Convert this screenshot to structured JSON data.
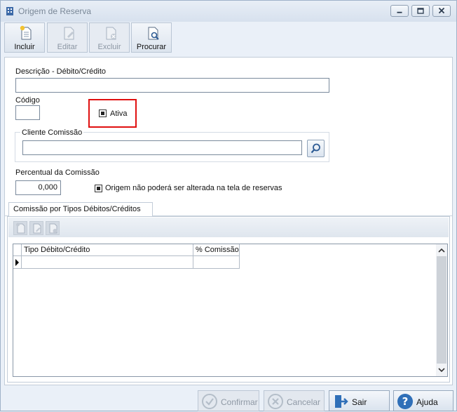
{
  "window": {
    "title": "Origem de Reserva"
  },
  "toolbar": {
    "incluir": "Incluir",
    "editar": "Editar",
    "excluir": "Excluir",
    "procurar": "Procurar"
  },
  "form": {
    "descricao_label": "Descrição - Débito/Crédito",
    "descricao_value": "",
    "codigo_label": "Código",
    "codigo_value": "",
    "ativa_label": "Ativa",
    "ativa_checked": true,
    "cliente_comissao_label": "Cliente Comissão",
    "cliente_comissao_value": "",
    "percentual_label": "Percentual da Comissão",
    "percentual_value": "0,000",
    "origem_label": "Origem não poderá ser alterada na tela de reservas",
    "origem_checked": true
  },
  "tab": {
    "label": "Comissão por Tipos Débitos/Créditos"
  },
  "grid": {
    "columns": [
      "Tipo Débito/Crédito",
      "% Comissão"
    ],
    "rows": [
      [
        "",
        ""
      ]
    ]
  },
  "actions": {
    "confirmar": "Confirmar",
    "cancelar": "Cancelar",
    "sair": "Sair",
    "ajuda": "Ajuda"
  }
}
